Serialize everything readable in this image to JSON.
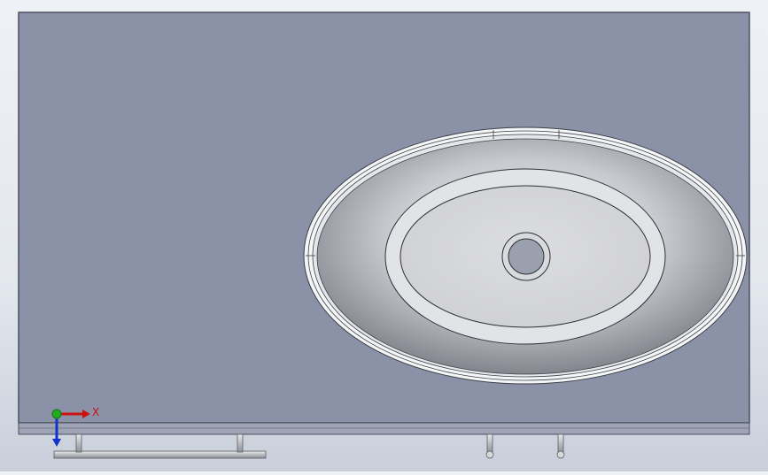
{
  "viewport": {
    "triad": {
      "x_label": "X",
      "colors": {
        "x": "#cc1111",
        "y": "#22aa22",
        "z": "#1133cc"
      }
    }
  },
  "colors": {
    "slab_face": "#8b92a8",
    "slab_edge": "#5a5f70",
    "basin_rim": "#f2f3f5",
    "basin_inner": "#b9bcc2",
    "basin_floor": "#d8d9dc",
    "drain": "#9aa0ad"
  }
}
